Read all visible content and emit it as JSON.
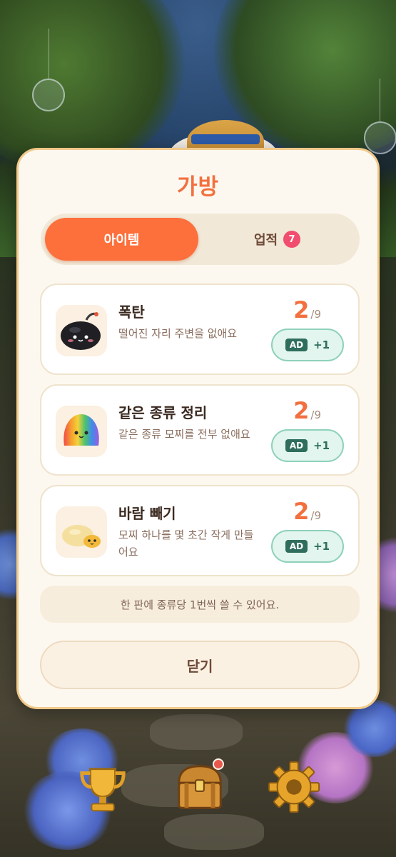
{
  "modal": {
    "title": "가방",
    "tabs": [
      {
        "label": "아이템",
        "active": true
      },
      {
        "label": "업적",
        "badge": "7"
      }
    ],
    "items": [
      {
        "name": "폭탄",
        "description": "떨어진 자리 주변을 없애요",
        "count": "2",
        "separator": "/",
        "max": "9",
        "ad_tag": "AD",
        "ad_reward": "+1",
        "icon": "bomb-icon"
      },
      {
        "name": "같은 종류 정리",
        "description": "같은 종류 모찌를 전부 없애요",
        "count": "2",
        "separator": "/",
        "max": "9",
        "ad_tag": "AD",
        "ad_reward": "+1",
        "icon": "rainbow-mochi-icon"
      },
      {
        "name": "바람 빼기",
        "description": "모찌 하나를 몇 초간 작게 만들어요",
        "count": "2",
        "separator": "/",
        "max": "9",
        "ad_tag": "AD",
        "ad_reward": "+1",
        "icon": "deflated-mochi-icon"
      }
    ],
    "note": "한 판에 종류당 1번씩 쓸 수 있어요.",
    "close_label": "닫기"
  },
  "bottom_nav": {
    "items": [
      {
        "icon": "trophy-icon"
      },
      {
        "icon": "treasure-chest-icon",
        "notification": true
      },
      {
        "icon": "gear-icon"
      }
    ]
  },
  "colors": {
    "accent": "#fd6f3b",
    "title": "#f2703f",
    "badge": "#f14d6e",
    "ad_green": "#2f6e5c"
  }
}
